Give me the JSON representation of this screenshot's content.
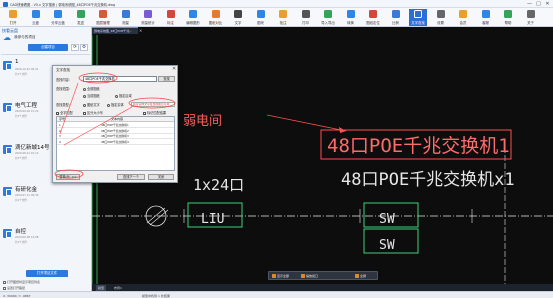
{
  "window": {
    "title": "CAD快速看图  -  V5.x  文字搜索  |  弱电系统图_48口POE千兆交换机.dwg",
    "controls": [
      "—",
      "□",
      "✕"
    ]
  },
  "ribbon": [
    {
      "label": "打开",
      "icon": "folder-icon",
      "color": "#e8a02a"
    },
    {
      "label": "云盘",
      "icon": "cloud-icon",
      "color": "#2f86e8"
    },
    {
      "label": "分享云盘",
      "icon": "share-icon",
      "color": "#2f86e8"
    },
    {
      "label": "发送",
      "icon": "send-icon",
      "color": "#36a35c"
    },
    {
      "label": "图层管理",
      "icon": "layers-icon",
      "color": "#d65a3a"
    },
    {
      "label": "测量",
      "icon": "ruler-icon",
      "color": "#3a7ad6"
    },
    {
      "label": "测量统计",
      "icon": "stats-icon",
      "color": "#7a5ad6"
    },
    {
      "label": "标注",
      "icon": "annotate-icon",
      "color": "#d6463a"
    },
    {
      "label": "编辑图形",
      "icon": "edit-icon",
      "color": "#2f86e8"
    },
    {
      "label": "图纸对比",
      "icon": "compare-icon",
      "color": "#e87a2a"
    },
    {
      "label": "文字",
      "icon": "text-icon",
      "color": "#444444"
    },
    {
      "label": "图块",
      "icon": "block-icon",
      "color": "#2f86e8"
    },
    {
      "label": "批注",
      "icon": "comment-icon",
      "color": "#e8a02a"
    },
    {
      "label": "打印",
      "icon": "print-icon",
      "color": "#555555"
    },
    {
      "label": "导入导出",
      "icon": "import-export-icon",
      "color": "#36a35c"
    },
    {
      "label": "转换",
      "icon": "convert-icon",
      "color": "#2f86e8"
    },
    {
      "label": "图纸定位",
      "icon": "locate-icon",
      "color": "#d6463a"
    },
    {
      "label": "比例",
      "icon": "scale-icon",
      "color": "#3a7ad6"
    },
    {
      "label": "文字查找",
      "icon": "search-text-icon",
      "color": "#ffffff",
      "active": true
    },
    {
      "label": "设置",
      "icon": "settings-icon",
      "color": "#666666"
    },
    {
      "label": "会员",
      "icon": "vip-icon",
      "color": "#e8a02a"
    },
    {
      "label": "客服",
      "icon": "service-icon",
      "color": "#2f86e8"
    },
    {
      "label": "帮助",
      "icon": "help-icon",
      "color": "#36a35c"
    },
    {
      "label": "关于",
      "icon": "about-icon",
      "color": "#666666"
    }
  ],
  "left_panel": {
    "title": "快看云盘",
    "project_name": "我参与的项目",
    "new_project_label": "创建项目",
    "refresh_icon": "⟳",
    "settings_icon": "⚙",
    "projects": [
      {
        "name": "1",
        "meta1": "2020-10-22 09:41",
        "meta2": "共1个文件"
      },
      {
        "name": "电气工程",
        "meta1": "2020-09-16 15:20",
        "meta2": "共3个文件"
      },
      {
        "name": "滴亿新城14号",
        "meta1": "2020-08-21 10:12",
        "meta2": "共5个文件"
      },
      {
        "name": "有研化金",
        "meta1": "2020-07-11 09:30",
        "meta2": "共2个文件"
      },
      {
        "name": "自控",
        "meta1": "2020-06-08 14:08",
        "meta2": "共4个文件"
      }
    ],
    "open_button": "打开项目文件",
    "option1": "打开图纸时显示项目列表",
    "option2": "设置打开路径"
  },
  "canvas": {
    "tab_label": "弱电系统图_48口POE千兆...",
    "tab_close": "×",
    "cad_text": {
      "weak_current": "弱电间",
      "highlighted": "48口POE千兆交换机1",
      "switch_label": "48口POE千兆交换机x1",
      "port_label": "1x24口",
      "liu": "LIU",
      "sw1": "SW",
      "sw2": "SW"
    }
  },
  "float_toolbar": {
    "item1": "显示全部",
    "item2": "缩放窗口",
    "item3": "全屏"
  },
  "model_tabs": [
    "模型",
    "布局1"
  ],
  "status": {
    "left": "X: 30900, Y: -9867",
    "middle": "模型中找到 1 处结果"
  },
  "dialog": {
    "title": "文字查找",
    "close": "✕",
    "find_label": "查找内容:",
    "find_value": "48口POE千兆交换机",
    "find_button": "查找",
    "scope_label": "查找范围:",
    "scope_all": "全部图纸",
    "scope_current": "当前图纸",
    "scope_region": "指定区域",
    "type_label": "查找类型:",
    "type_text": "图纸文字",
    "type_entity": "指定实体",
    "entity_dropdown": "指定实体文字在当前图层可用",
    "whole_word": "全字匹配",
    "case_option": "区分大小写",
    "highlight_option": "标记匹配结果",
    "table_header_num": "序号",
    "table_header_text": "文本内容",
    "results": [
      {
        "num": "1",
        "text": "48口POE千兆交换机1"
      },
      {
        "num": "2",
        "text": "48口POE千兆交换机2"
      },
      {
        "num": "3",
        "text": "48口POE千兆交换机3"
      },
      {
        "num": "4",
        "text": "48口POE千兆交换机4"
      }
    ],
    "replace_button": "替换(R) >>",
    "next_button": "查找下一个",
    "cancel_button": "关闭"
  }
}
